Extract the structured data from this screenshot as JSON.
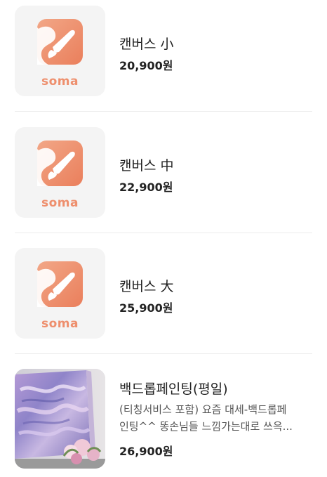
{
  "products": [
    {
      "brand": "soma",
      "title": "캔버스 小",
      "price": "20,900원"
    },
    {
      "brand": "soma",
      "title": "캔버스 中",
      "price": "22,900원"
    },
    {
      "brand": "soma",
      "title": "캔버스 大",
      "price": "25,900원"
    }
  ],
  "painting": {
    "title": "백드롭페인팅(평일)",
    "desc_line1": "(티칭서비스 포함) 요즘 대세-백드롭페",
    "desc_line2": "인팅^^ 똥손님들 느낌가는대로 쓰윽...",
    "price": "26,900원"
  },
  "colors": {
    "brand_orange": "#ee8f6d",
    "thumb_bg": "#f4f4f4"
  },
  "icons": {
    "logo": "paintbrush-logo-icon"
  }
}
